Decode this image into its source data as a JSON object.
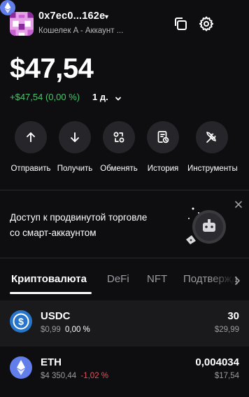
{
  "account": {
    "name": "0x7ec0...162e",
    "subtitle": "Кошелек A - Аккаунт ..."
  },
  "colors": {
    "accent": "#627eea",
    "positive": "#4cc36d",
    "negative": "#e8505b",
    "usdc": "#2775ca"
  },
  "header_icons": [
    "copy-icon",
    "gear-icon",
    "ethereum-network-icon"
  ],
  "balance": {
    "total": "$47,54",
    "change": "+$47,54 (0,00 %)",
    "period": "1 д."
  },
  "actions": [
    {
      "label": "Отправить",
      "icon": "arrow-up-icon"
    },
    {
      "label": "Получить",
      "icon": "arrow-down-icon"
    },
    {
      "label": "Обменять",
      "icon": "swap-icon"
    },
    {
      "label": "История",
      "icon": "history-icon"
    },
    {
      "label": "Инструменты",
      "icon": "tools-icon"
    }
  ],
  "promo": {
    "line1": "Доступ к продвинутой торговле",
    "line2": "со смарт-аккаунтом"
  },
  "tabs": [
    {
      "label": "Криптовалюта",
      "active": true
    },
    {
      "label": "DeFi",
      "active": false
    },
    {
      "label": "NFT",
      "active": false
    },
    {
      "label": "Подтвержд",
      "active": false
    }
  ],
  "assets": [
    {
      "symbol": "USDC",
      "price": "$0,99",
      "change": "0,00 %",
      "amount": "30",
      "fiat": "$29,99"
    },
    {
      "symbol": "ETH",
      "price": "$4 350,44",
      "change": "-1,02 %",
      "amount": "0,004034",
      "fiat": "$17,54"
    }
  ]
}
